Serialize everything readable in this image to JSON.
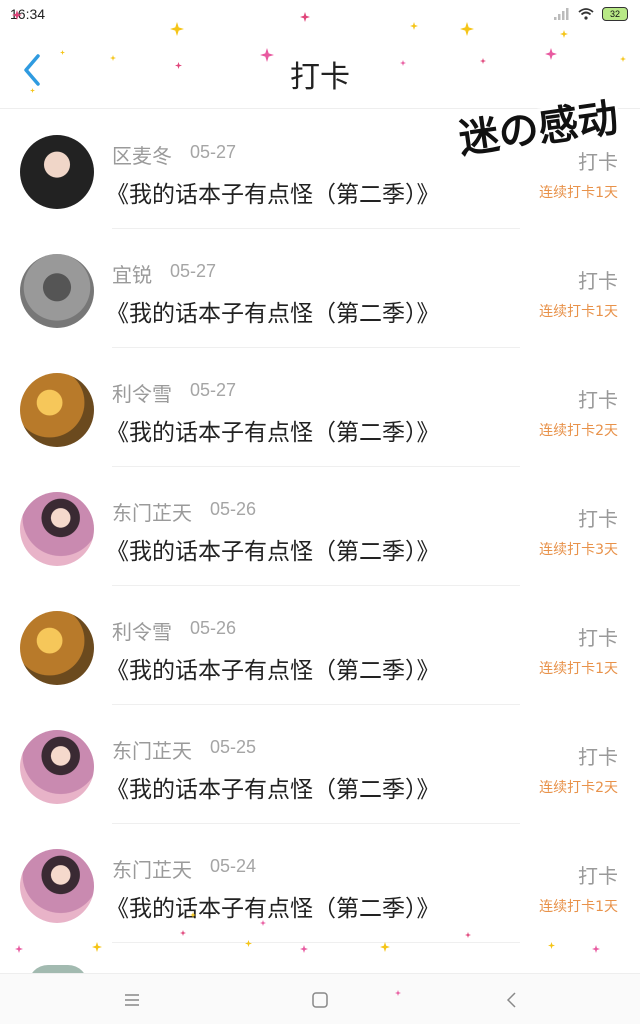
{
  "status_bar": {
    "time": "16:34",
    "battery": "32"
  },
  "header": {
    "title": "打卡"
  },
  "sticker_text": "迷の感动",
  "records": [
    {
      "name": "区麦冬",
      "date": "05-27",
      "book": "《我的话本子有点怪（第二季）》",
      "label": "打卡",
      "streak": "连续打卡1天",
      "avatar": "dark"
    },
    {
      "name": "宜锐",
      "date": "05-27",
      "book": "《我的话本子有点怪（第二季）》",
      "label": "打卡",
      "streak": "连续打卡1天",
      "avatar": "gray"
    },
    {
      "name": "利令雪",
      "date": "05-27",
      "book": "《我的话本子有点怪（第二季）》",
      "label": "打卡",
      "streak": "连续打卡2天",
      "avatar": "amber"
    },
    {
      "name": "东门芷天",
      "date": "05-26",
      "book": "《我的话本子有点怪（第二季）》",
      "label": "打卡",
      "streak": "连续打卡3天",
      "avatar": "pink"
    },
    {
      "name": "利令雪",
      "date": "05-26",
      "book": "《我的话本子有点怪（第二季）》",
      "label": "打卡",
      "streak": "连续打卡1天",
      "avatar": "amber"
    },
    {
      "name": "东门芷天",
      "date": "05-25",
      "book": "《我的话本子有点怪（第二季）》",
      "label": "打卡",
      "streak": "连续打卡2天",
      "avatar": "pink"
    },
    {
      "name": "东门芷天",
      "date": "05-24",
      "book": "《我的话本子有点怪（第二季）》",
      "label": "打卡",
      "streak": "连续打卡1天",
      "avatar": "pink"
    }
  ],
  "colors": {
    "accent_blue": "#2f9be0",
    "streak_orange": "#e8924a",
    "name_gray": "#9a9a9a"
  },
  "nav_icons": [
    "menu-icon",
    "home-square-icon",
    "back-chevron-icon"
  ]
}
